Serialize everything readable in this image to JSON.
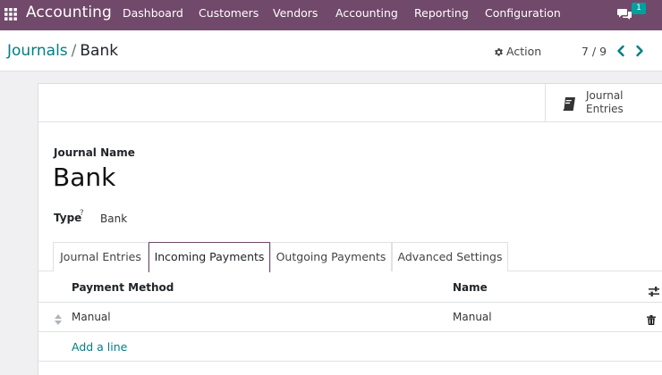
{
  "navbar": {
    "app_icon": "apps-grid-icon",
    "app_name": "Accounting",
    "menu": [
      "Dashboard",
      "Customers",
      "Vendors",
      "Accounting",
      "Reporting",
      "Configuration"
    ],
    "chat_icon": "chat-bubbles-icon",
    "chat_count": "1",
    "bg_color": "#71496a"
  },
  "breadcrumb": {
    "parent": "Journals",
    "separator": "/",
    "current": "Bank"
  },
  "toolbar": {
    "action_icon": "gear-icon",
    "action_label": "Action",
    "pager_value": "7 / 9",
    "prev_icon": "chevron-left-icon",
    "next_icon": "chevron-right-icon"
  },
  "smart_button": {
    "icon": "book-icon",
    "label": "Journal\nEntries"
  },
  "form": {
    "journal_name_label": "Journal Name",
    "journal_name": "Bank",
    "type_label": "Type",
    "type_help": "?",
    "type_value": "Bank"
  },
  "tabs": [
    {
      "label": "Journal Entries",
      "active": false
    },
    {
      "label": "Incoming Payments",
      "active": true
    },
    {
      "label": "Outgoing Payments",
      "active": false
    },
    {
      "label": "Advanced Settings",
      "active": false
    }
  ],
  "table": {
    "columns": [
      "Payment Method",
      "Name"
    ],
    "column_toggle_icon": "sliders-icon",
    "rows": [
      {
        "payment_method": "Manual",
        "name": "Manual"
      }
    ],
    "row_handle_icon": "drag-handle-icon",
    "row_delete_icon": "trash-icon",
    "add_line_label": "Add a line"
  },
  "colors": {
    "accent": "#71496a",
    "link": "#017e84"
  }
}
